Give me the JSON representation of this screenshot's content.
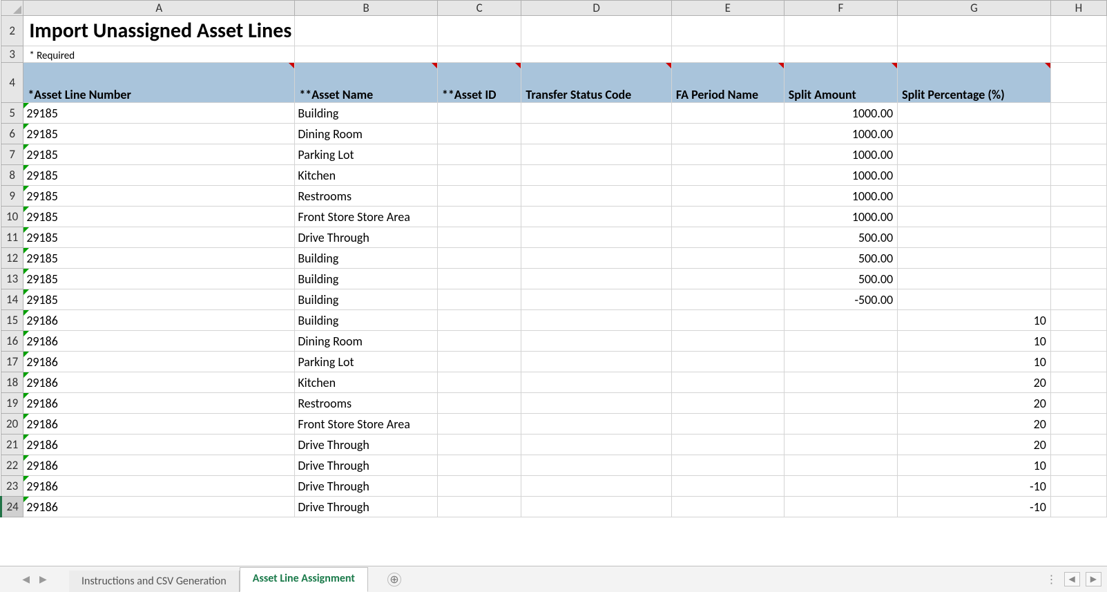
{
  "columns": [
    "A",
    "B",
    "C",
    "D",
    "E",
    "F",
    "G",
    "H"
  ],
  "row_start": 2,
  "title": "Import Unassigned Asset Lines",
  "required_note": "* Required",
  "headers": {
    "A": "*Asset Line Number",
    "B": "**Asset Name",
    "C": "**Asset ID",
    "D": "Transfer Status Code",
    "E": "FA Period Name",
    "F": "Split Amount",
    "G": "Split Percentage (%)"
  },
  "rows": [
    {
      "n": 5,
      "A": "29185",
      "B": "Building",
      "F": "1000.00"
    },
    {
      "n": 6,
      "A": "29185",
      "B": "Dining Room",
      "F": "1000.00"
    },
    {
      "n": 7,
      "A": "29185",
      "B": "Parking Lot",
      "F": "1000.00"
    },
    {
      "n": 8,
      "A": "29185",
      "B": "Kitchen",
      "F": "1000.00"
    },
    {
      "n": 9,
      "A": "29185",
      "B": "Restrooms",
      "F": "1000.00"
    },
    {
      "n": 10,
      "A": "29185",
      "B": "Front Store Store Area",
      "F": "1000.00"
    },
    {
      "n": 11,
      "A": "29185",
      "B": "Drive Through",
      "F": "500.00"
    },
    {
      "n": 12,
      "A": "29185",
      "B": "Building",
      "F": "500.00"
    },
    {
      "n": 13,
      "A": "29185",
      "B": "Building",
      "F": "500.00"
    },
    {
      "n": 14,
      "A": "29185",
      "B": "Building",
      "F": "-500.00"
    },
    {
      "n": 15,
      "A": "29186",
      "B": "Building",
      "G": "10"
    },
    {
      "n": 16,
      "A": "29186",
      "B": "Dining Room",
      "G": "10"
    },
    {
      "n": 17,
      "A": "29186",
      "B": "Parking Lot",
      "G": "10"
    },
    {
      "n": 18,
      "A": "29186",
      "B": "Kitchen",
      "G": "20"
    },
    {
      "n": 19,
      "A": "29186",
      "B": "Restrooms",
      "G": "20"
    },
    {
      "n": 20,
      "A": "29186",
      "B": "Front Store Store Area",
      "G": "20"
    },
    {
      "n": 21,
      "A": "29186",
      "B": "Drive Through",
      "G": "20"
    },
    {
      "n": 22,
      "A": "29186",
      "B": "Drive Through",
      "G": "10"
    },
    {
      "n": 23,
      "A": "29186",
      "B": "Drive Through",
      "G": "-10"
    },
    {
      "n": 24,
      "A": "29186",
      "B": "Drive Through",
      "G": "-10"
    }
  ],
  "active_row": 24,
  "tabs": {
    "items": [
      {
        "label": "Instructions and CSV Generation",
        "active": false
      },
      {
        "label": "Asset Line Assignment",
        "active": true
      }
    ],
    "new_tab_glyph": "⊕"
  },
  "nav": {
    "left": "◀",
    "right": "▶",
    "dots": "⋮",
    "scroll_left": "◀",
    "scroll_right": "▶"
  }
}
